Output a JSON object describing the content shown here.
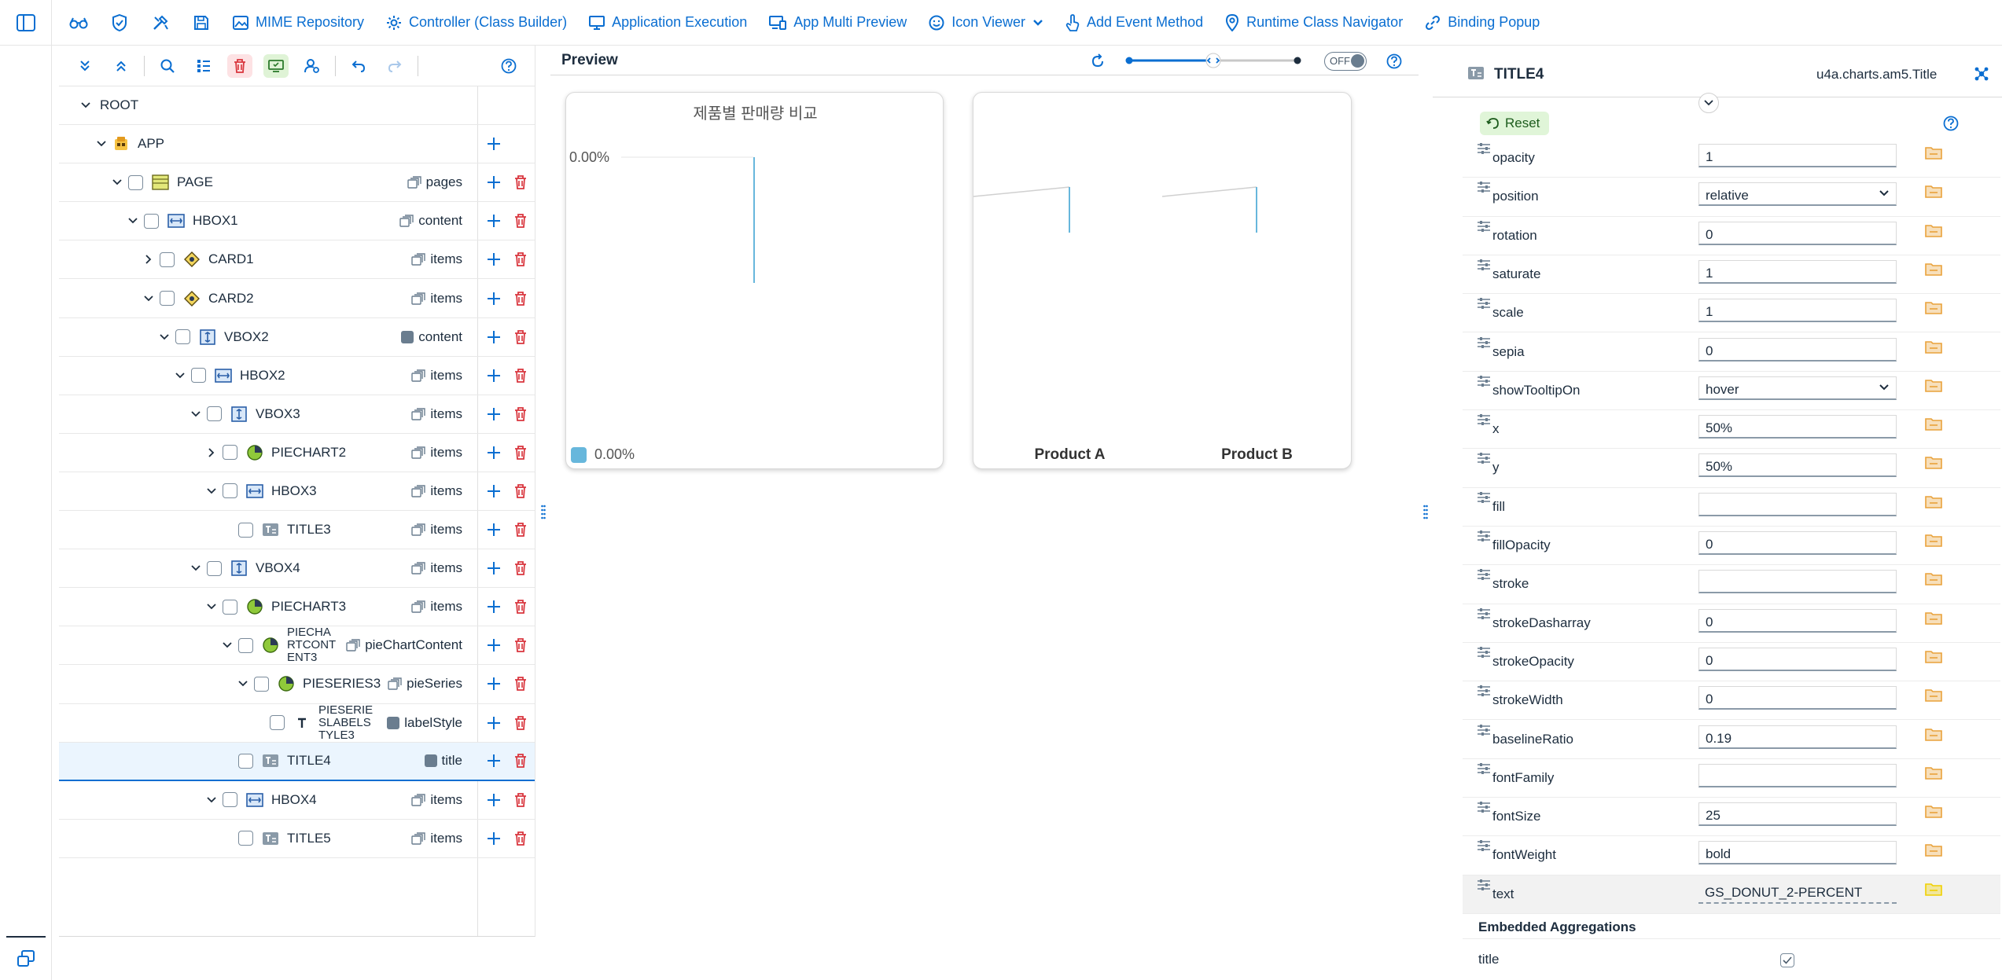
{
  "toolbar": {
    "items": [
      {
        "label": "MIME Repository",
        "icon": "image-icon"
      },
      {
        "label": "Controller (Class Builder)",
        "icon": "gear-icon"
      },
      {
        "label": "Application Execution",
        "icon": "display-icon"
      },
      {
        "label": "App Multi Preview",
        "icon": "multi-device-icon"
      },
      {
        "label": "Icon Viewer",
        "icon": "smiley-icon"
      },
      {
        "label": "Add Event Method",
        "icon": "hand-icon"
      },
      {
        "label": "Runtime Class Navigator",
        "icon": "pin-icon"
      },
      {
        "label": "Binding Popup",
        "icon": "link-icon"
      }
    ]
  },
  "tree": {
    "rows": [
      {
        "label": "ROOT",
        "level": 0,
        "expand": "down",
        "check": false,
        "icon": "",
        "agg": "",
        "agg_icon": "",
        "actions": false
      },
      {
        "label": "APP",
        "level": 1,
        "expand": "down",
        "check": false,
        "icon": "app-icon",
        "agg": "",
        "agg_icon": "",
        "actions": "add"
      },
      {
        "label": "PAGE",
        "level": 2,
        "expand": "down",
        "check": true,
        "icon": "page-icon",
        "agg": "pages",
        "agg_icon": "multi",
        "actions": true
      },
      {
        "label": "HBOX1",
        "level": 3,
        "expand": "down",
        "check": true,
        "icon": "hbox-icon",
        "agg": "content",
        "agg_icon": "multi",
        "actions": true
      },
      {
        "label": "CARD1",
        "level": 4,
        "expand": "right",
        "check": true,
        "icon": "card-icon",
        "agg": "items",
        "agg_icon": "multi",
        "actions": true
      },
      {
        "label": "CARD2",
        "level": 4,
        "expand": "down",
        "check": true,
        "icon": "card-icon",
        "agg": "items",
        "agg_icon": "multi",
        "actions": true
      },
      {
        "label": "VBOX2",
        "level": 5,
        "expand": "down",
        "check": true,
        "icon": "vbox-icon",
        "agg": "content",
        "agg_icon": "single",
        "actions": true
      },
      {
        "label": "HBOX2",
        "level": 6,
        "expand": "down",
        "check": true,
        "icon": "hbox-icon",
        "agg": "items",
        "agg_icon": "multi",
        "actions": true
      },
      {
        "label": "VBOX3",
        "level": 7,
        "expand": "down",
        "check": true,
        "icon": "vbox-icon",
        "agg": "items",
        "agg_icon": "multi",
        "actions": true
      },
      {
        "label": "PIECHART2",
        "level": 8,
        "expand": "right",
        "check": true,
        "icon": "chart-icon",
        "agg": "items",
        "agg_icon": "multi",
        "actions": true
      },
      {
        "label": "HBOX3",
        "level": 8,
        "expand": "down",
        "check": true,
        "icon": "hbox-icon",
        "agg": "items",
        "agg_icon": "multi",
        "actions": true
      },
      {
        "label": "TITLE3",
        "level": 9,
        "expand": "",
        "check": true,
        "icon": "title-icon",
        "agg": "items",
        "agg_icon": "multi",
        "actions": true
      },
      {
        "label": "VBOX4",
        "level": 7,
        "expand": "down",
        "check": true,
        "icon": "vbox-icon",
        "agg": "items",
        "agg_icon": "multi",
        "actions": true
      },
      {
        "label": "PIECHART3",
        "level": 8,
        "expand": "down",
        "check": true,
        "icon": "chart-icon",
        "agg": "items",
        "agg_icon": "multi",
        "actions": true
      },
      {
        "label": "PIECHA RTCONT ENT3",
        "level": 9,
        "expand": "down",
        "check": true,
        "icon": "chart-icon",
        "agg": "pieChartContent",
        "agg_icon": "multi",
        "actions": true,
        "small": true
      },
      {
        "label": "PIESERIES3",
        "level": 10,
        "expand": "down",
        "check": true,
        "icon": "chart-icon",
        "agg": "pieSeries",
        "agg_icon": "multi",
        "actions": true
      },
      {
        "label": "PIESERIE SLABELS TYLE3",
        "level": 11,
        "expand": "",
        "check": true,
        "icon": "text-icon",
        "agg": "labelStyle",
        "agg_icon": "single",
        "actions": true,
        "small": true
      },
      {
        "label": "TITLE4",
        "level": 9,
        "expand": "",
        "check": true,
        "icon": "title-icon",
        "agg": "title",
        "agg_icon": "single",
        "actions": true,
        "selected": true
      },
      {
        "label": "HBOX4",
        "level": 8,
        "expand": "down",
        "check": true,
        "icon": "hbox-icon",
        "agg": "items",
        "agg_icon": "multi",
        "actions": true
      },
      {
        "label": "TITLE5",
        "level": 9,
        "expand": "",
        "check": true,
        "icon": "title-icon",
        "agg": "items",
        "agg_icon": "multi",
        "actions": true
      }
    ]
  },
  "preview": {
    "title": "Preview",
    "toggle_label": "OFF",
    "slider_value": 0.5,
    "card1": {
      "title": "제품별 판매량 비교",
      "value_label": "0.00%",
      "legend_label": "0.00%",
      "legend_color": "#67b7dc"
    },
    "card2": {
      "labels": [
        "Product A",
        "Product B"
      ]
    }
  },
  "props": {
    "title": "TITLE4",
    "class_name": "u4a.charts.am5.Title",
    "reset_label": "Reset",
    "rows": [
      {
        "name": "opacity",
        "value": "1",
        "type": "input"
      },
      {
        "name": "position",
        "value": "relative",
        "type": "select"
      },
      {
        "name": "rotation",
        "value": "0",
        "type": "input"
      },
      {
        "name": "saturate",
        "value": "1",
        "type": "input"
      },
      {
        "name": "scale",
        "value": "1",
        "type": "input"
      },
      {
        "name": "sepia",
        "value": "0",
        "type": "input"
      },
      {
        "name": "showTooltipOn",
        "value": "hover",
        "type": "select"
      },
      {
        "name": "x",
        "value": "50%",
        "type": "input"
      },
      {
        "name": "y",
        "value": "50%",
        "type": "input"
      },
      {
        "name": "fill",
        "value": "",
        "type": "input"
      },
      {
        "name": "fillOpacity",
        "value": "0",
        "type": "input"
      },
      {
        "name": "stroke",
        "value": "",
        "type": "input"
      },
      {
        "name": "strokeDasharray",
        "value": "0",
        "type": "input"
      },
      {
        "name": "strokeOpacity",
        "value": "0",
        "type": "input"
      },
      {
        "name": "strokeWidth",
        "value": "0",
        "type": "input"
      },
      {
        "name": "baselineRatio",
        "value": "0.19",
        "type": "input"
      },
      {
        "name": "fontFamily",
        "value": "",
        "type": "input"
      },
      {
        "name": "fontSize",
        "value": "25",
        "type": "input"
      },
      {
        "name": "fontWeight",
        "value": "bold",
        "type": "input"
      },
      {
        "name": "text",
        "value": "GS_DONUT_2-PERCENT",
        "type": "input",
        "bound": true
      }
    ],
    "embedded_heading": "Embedded Aggregations",
    "embedded": [
      {
        "name": "title",
        "checked": true
      }
    ]
  },
  "colors": {
    "accent": "#0a6ed1",
    "delete": "#d9363e",
    "chart": "#67b7dc",
    "bind_folder": "#e9a23b",
    "bind_folder_active": "#f0d000"
  }
}
